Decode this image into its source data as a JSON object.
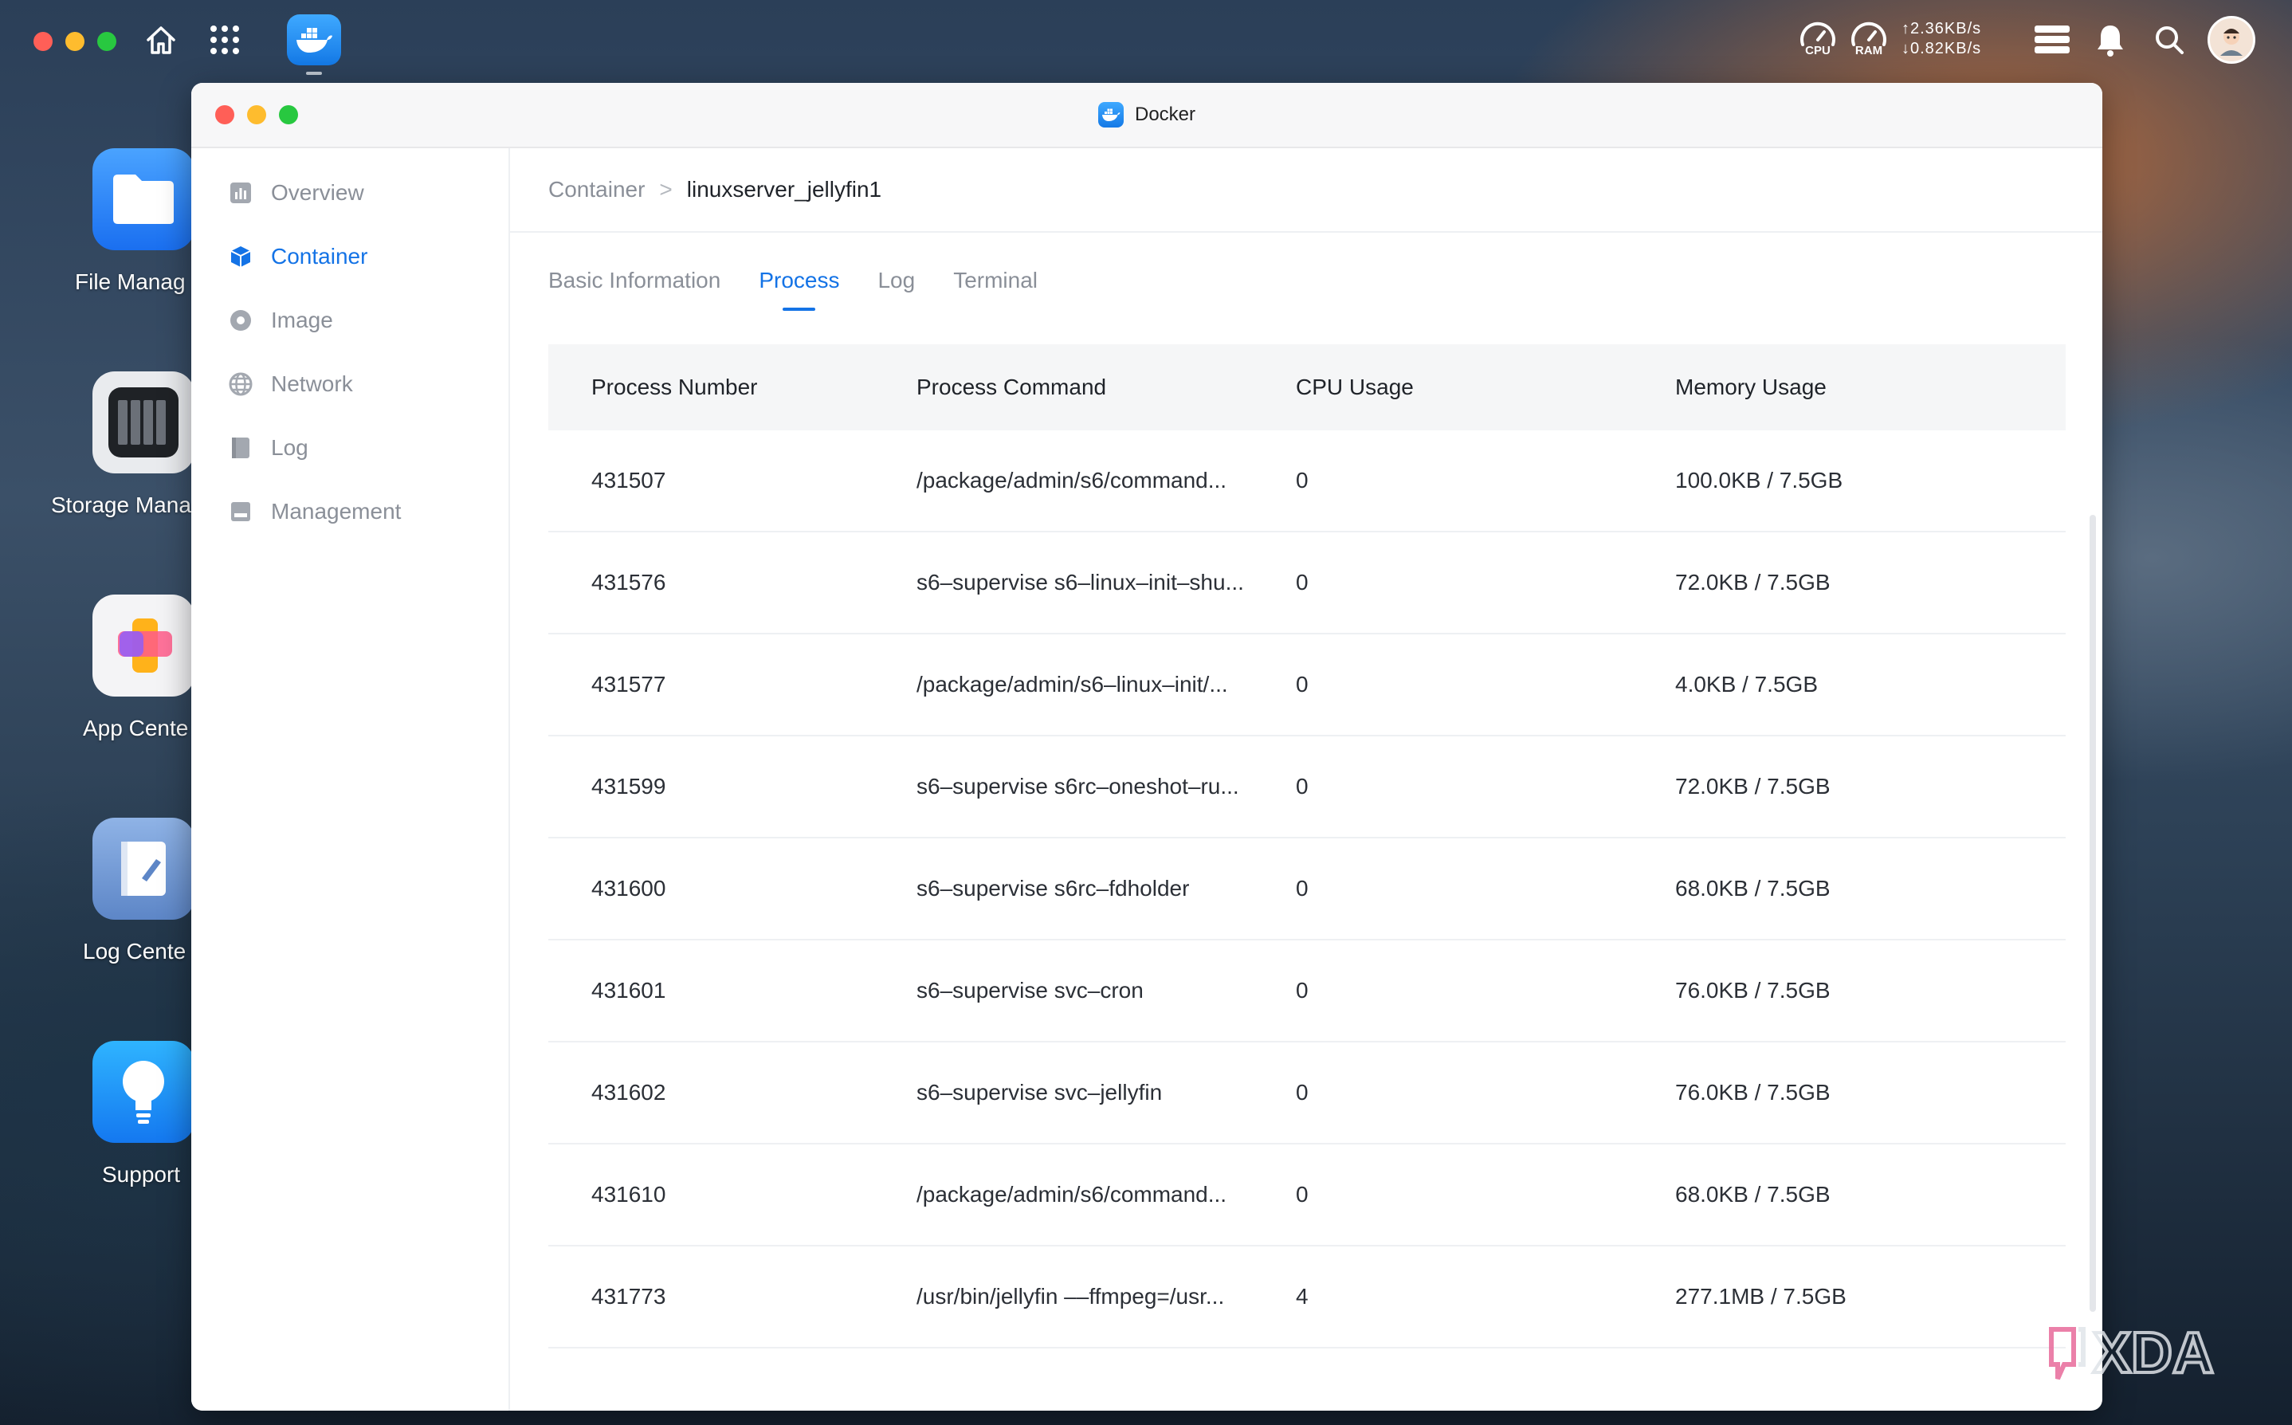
{
  "topbar": {
    "cpu_label": "CPU",
    "ram_label": "RAM",
    "upload": "↑2.36KB/s",
    "download": "↓0.82KB/s"
  },
  "desktop": {
    "icons": [
      {
        "label": "File Manag"
      },
      {
        "label": "Storage Mana"
      },
      {
        "label": "App Cente"
      },
      {
        "label": "Log Cente"
      },
      {
        "label": "Support"
      }
    ]
  },
  "window": {
    "title": "Docker"
  },
  "sidebar": {
    "items": [
      {
        "label": "Overview",
        "icon": "overview-icon"
      },
      {
        "label": "Container",
        "icon": "container-icon"
      },
      {
        "label": "Image",
        "icon": "image-icon"
      },
      {
        "label": "Network",
        "icon": "network-icon"
      },
      {
        "label": "Log",
        "icon": "log-icon"
      },
      {
        "label": "Management",
        "icon": "management-icon"
      }
    ],
    "active": "Container"
  },
  "breadcrumb": {
    "parent": "Container",
    "separator": ">",
    "current": "linuxserver_jellyfin1"
  },
  "tabs": [
    {
      "label": "Basic Information"
    },
    {
      "label": "Process"
    },
    {
      "label": "Log"
    },
    {
      "label": "Terminal"
    }
  ],
  "active_tab": "Process",
  "table": {
    "columns": [
      "Process Number",
      "Process Command",
      "CPU Usage",
      "Memory Usage"
    ],
    "rows": [
      [
        "431507",
        "/package/admin/s6/command...",
        "0",
        "100.0KB / 7.5GB"
      ],
      [
        "431576",
        "s6–supervise s6–linux–init–shu...",
        "0",
        "72.0KB / 7.5GB"
      ],
      [
        "431577",
        "/package/admin/s6–linux–init/...",
        "0",
        "4.0KB / 7.5GB"
      ],
      [
        "431599",
        "s6–supervise s6rc–oneshot–ru...",
        "0",
        "72.0KB / 7.5GB"
      ],
      [
        "431600",
        "s6–supervise s6rc–fdholder",
        "0",
        "68.0KB / 7.5GB"
      ],
      [
        "431601",
        "s6–supervise svc–cron",
        "0",
        "76.0KB / 7.5GB"
      ],
      [
        "431602",
        "s6–supervise svc–jellyfin",
        "0",
        "76.0KB / 7.5GB"
      ],
      [
        "431610",
        "/package/admin/s6/command...",
        "0",
        "68.0KB / 7.5GB"
      ],
      [
        "431773",
        "/usr/bin/jellyfin ––ffmpeg=/usr...",
        "4",
        "277.1MB / 7.5GB"
      ]
    ]
  },
  "colors": {
    "accent": "#1473e6",
    "traffic_red": "#ff5f57",
    "traffic_yellow": "#febc2e",
    "traffic_green": "#28c840"
  }
}
